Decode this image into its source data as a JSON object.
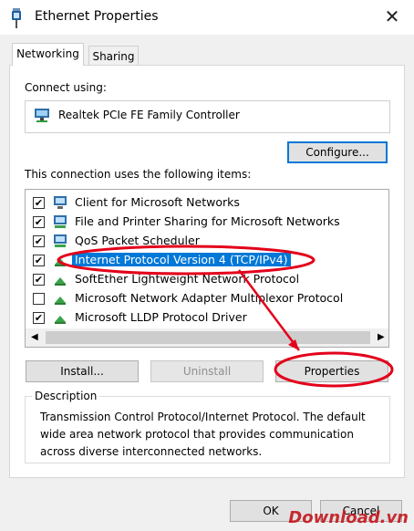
{
  "window": {
    "title": "Ethernet Properties"
  },
  "tabs": [
    {
      "label": "Networking",
      "active": true
    },
    {
      "label": "Sharing",
      "active": false
    }
  ],
  "connect_using": {
    "label": "Connect using:",
    "adapter": "Realtek PCIe FE Family Controller",
    "configure_button": "Configure..."
  },
  "items_section": {
    "label": "This connection uses the following items:",
    "items": [
      {
        "checked": true,
        "label": "Client for Microsoft Networks",
        "icon": "network-client-icon"
      },
      {
        "checked": true,
        "label": "File and Printer Sharing for Microsoft Networks",
        "icon": "network-service-icon"
      },
      {
        "checked": true,
        "label": "QoS Packet Scheduler",
        "icon": "network-service-icon"
      },
      {
        "checked": true,
        "label": "Internet Protocol Version 4 (TCP/IPv4)",
        "icon": "protocol-icon",
        "selected": true
      },
      {
        "checked": true,
        "label": "SoftEther Lightweight Network Protocol",
        "icon": "protocol-icon"
      },
      {
        "checked": false,
        "label": "Microsoft Network Adapter Multiplexor Protocol",
        "icon": "protocol-icon"
      },
      {
        "checked": true,
        "label": "Microsoft LLDP Protocol Driver",
        "icon": "protocol-icon"
      }
    ]
  },
  "buttons": {
    "install": "Install...",
    "uninstall": "Uninstall",
    "properties": "Properties",
    "ok": "OK",
    "cancel": "Cancel"
  },
  "description": {
    "title": "Description",
    "text": "Transmission Control Protocol/Internet Protocol. The default wide area network protocol that provides communication across diverse interconnected networks."
  },
  "watermark": "Download.vn",
  "colors": {
    "selection": "#0078d7",
    "annotation": "#e3001b"
  }
}
